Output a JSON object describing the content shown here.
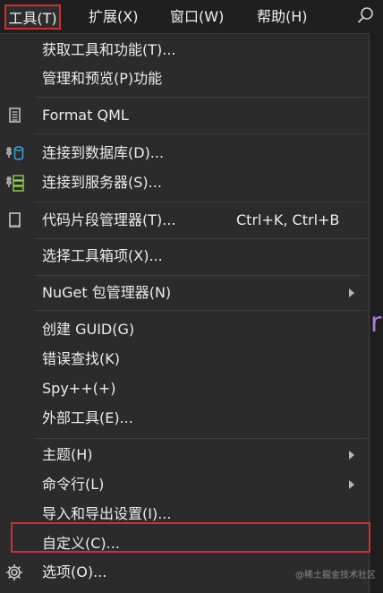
{
  "menubar": {
    "items": [
      {
        "label": "工具(T)"
      },
      {
        "label": "扩展(X)"
      },
      {
        "label": "窗口(W)"
      },
      {
        "label": "帮助(H)"
      }
    ],
    "search_icon": "search-icon"
  },
  "menu": {
    "items": [
      {
        "label": "获取工具和功能(T)..."
      },
      {
        "label": "管理和预览(P)功能"
      },
      {
        "label": "Format QML",
        "icon": "document-icon"
      },
      {
        "label": "连接到数据库(D)...",
        "icon": "database-connect-icon"
      },
      {
        "label": "连接到服务器(S)...",
        "icon": "server-connect-icon"
      },
      {
        "label": "代码片段管理器(T)...",
        "icon": "snippet-icon",
        "shortcut": "Ctrl+K, Ctrl+B"
      },
      {
        "label": "选择工具箱项(X)..."
      },
      {
        "label": "NuGet 包管理器(N)",
        "submenu": true
      },
      {
        "label": "创建 GUID(G)"
      },
      {
        "label": "错误查找(K)"
      },
      {
        "label": "Spy++(+)"
      },
      {
        "label": "外部工具(E)..."
      },
      {
        "label": "主题(H)",
        "submenu": true
      },
      {
        "label": "命令行(L)",
        "submenu": true
      },
      {
        "label": "导入和导出设置(I)..."
      },
      {
        "label": "自定义(C)...",
        "highlighted": true
      },
      {
        "label": "选项(O)...",
        "icon": "gear-icon"
      }
    ]
  },
  "editor_peek": {
    "letter": "r"
  },
  "watermark": "@稀土掘金技术社区",
  "colors": {
    "highlight_border": "#d42d2d",
    "menu_bg": "#2b2b2c",
    "menubar_bg": "#1f1f1f",
    "peek_letter": "#b07ad6"
  }
}
